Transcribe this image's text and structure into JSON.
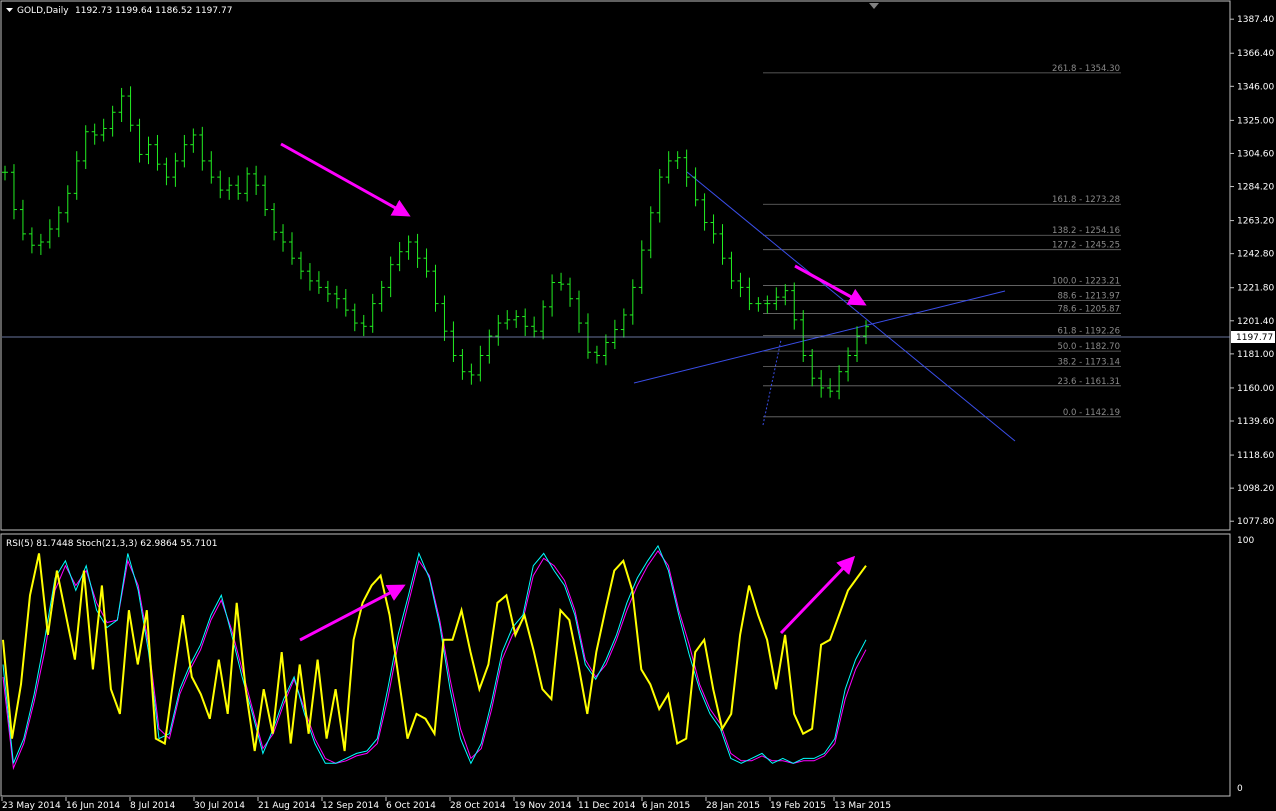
{
  "header": {
    "symbol_label": "GOLD,Daily",
    "ohlc_text": "1192.73 1199.64 1186.52 1197.77"
  },
  "indicator_header": {
    "text": "RSI(5) 81.7448  Stoch(21,3,3) 62.9864 55.7101"
  },
  "colors": {
    "background": "#000000",
    "candle": "#22ee22",
    "rsi": "#ffff00",
    "stoch_main": "#00ffff",
    "stoch_signal": "#ff00ff",
    "arrows": "#ff00ff",
    "trendline": "#3a4ee8",
    "fibo": "#707070",
    "frame": "#c0c0c0"
  },
  "chart_data": [
    {
      "type": "line",
      "title": "GOLD,Daily",
      "ylim": [
        1073.0,
        1398.0
      ],
      "y_ticks": [
        "1387.40",
        "1366.40",
        "1346.00",
        "1325.00",
        "1304.60",
        "1284.20",
        "1263.20",
        "1242.80",
        "1221.80",
        "1201.40",
        "1181.00",
        "1160.00",
        "1139.60",
        "1118.60",
        "1098.20",
        "1077.80"
      ],
      "current_price": "1197.77",
      "x_tick_labels": [
        "23 May 2014",
        "16 Jun 2014",
        "8 Jul 2014",
        "30 Jul 2014",
        "21 Aug 2014",
        "12 Sep 2014",
        "6 Oct 2014",
        "28 Oct 2014",
        "19 Nov 2014",
        "11 Dec 2014",
        "6 Jan 2015",
        "28 Jan 2015",
        "19 Feb 2015",
        "13 Mar 2015"
      ],
      "series": [
        {
          "values": [
            1293,
            1270,
            1255,
            1248,
            1250,
            1258,
            1268,
            1280,
            1300,
            1318,
            1316,
            1320,
            1330,
            1340,
            1322,
            1304,
            1310,
            1298,
            1290,
            1300,
            1310,
            1316,
            1300,
            1290,
            1282,
            1285,
            1280,
            1292,
            1285,
            1270,
            1256,
            1250,
            1240,
            1232,
            1226,
            1222,
            1218,
            1215,
            1208,
            1200,
            1198,
            1212,
            1222,
            1236,
            1244,
            1250,
            1240,
            1232,
            1212,
            1195,
            1180,
            1170,
            1168,
            1180,
            1192,
            1200,
            1202,
            1204,
            1198,
            1195,
            1210,
            1225,
            1224,
            1215,
            1200,
            1182,
            1180,
            1188,
            1196,
            1205,
            1222,
            1245,
            1268,
            1290,
            1300,
            1302,
            1290,
            1276,
            1262,
            1255,
            1240,
            1226,
            1222,
            1212,
            1212,
            1212,
            1216,
            1220,
            1202,
            1180,
            1166,
            1160,
            1158,
            1170,
            1180,
            1192,
            1197.77
          ]
        }
      ],
      "fibonacci_levels": [
        {
          "label": "261.8 - 1354.30",
          "price": 1354.3
        },
        {
          "label": "161.8 - 1273.28",
          "price": 1273.28
        },
        {
          "label": "138.2 - 1254.16",
          "price": 1254.16
        },
        {
          "label": "127.2 - 1245.25",
          "price": 1245.25
        },
        {
          "label": "100.0 - 1223.21",
          "price": 1223.21
        },
        {
          "label": "88.6 - 1213.97",
          "price": 1213.97
        },
        {
          "label": "78.6 - 1205.87",
          "price": 1205.87
        },
        {
          "label": "61.8 - 1192.26",
          "price": 1192.26
        },
        {
          "label": "50.0 - 1182.70",
          "price": 1182.7
        },
        {
          "label": "38.2 - 1173.14",
          "price": 1173.14
        },
        {
          "label": "23.6 - 1161.31",
          "price": 1161.31
        },
        {
          "label": "0.0 - 1142.19",
          "price": 1142.19
        }
      ]
    },
    {
      "type": "line",
      "title": "RSI(5) 81.7448  Stoch(21,3,3) 62.9864 55.7101",
      "ylim": [
        0,
        100
      ],
      "y_ticks": [
        "100",
        "0"
      ],
      "series": [
        {
          "name": "RSI(5)",
          "values": [
            60,
            20,
            42,
            78,
            95,
            62,
            88,
            70,
            52,
            88,
            48,
            82,
            40,
            30,
            72,
            50,
            72,
            20,
            18,
            45,
            70,
            45,
            38,
            28,
            52,
            30,
            75,
            40,
            15,
            40,
            22,
            55,
            18,
            50,
            22,
            52,
            20,
            40,
            15,
            60,
            75,
            82,
            86,
            70,
            45,
            20,
            30,
            28,
            22,
            60,
            60,
            72,
            55,
            40,
            50,
            75,
            78,
            62,
            70,
            56,
            40,
            36,
            72,
            68,
            50,
            30,
            55,
            72,
            88,
            92,
            80,
            48,
            42,
            32,
            38,
            18,
            20,
            55,
            60,
            40,
            24,
            30,
            62,
            82,
            70,
            60,
            40,
            62,
            30,
            22,
            24,
            58,
            60,
            70,
            80,
            85,
            90
          ]
        },
        {
          "name": "Stoch main",
          "values": [
            50,
            10,
            20,
            38,
            60,
            85,
            92,
            80,
            90,
            72,
            65,
            68,
            95,
            80,
            55,
            20,
            22,
            40,
            50,
            58,
            70,
            78,
            62,
            45,
            30,
            14,
            24,
            36,
            45,
            30,
            18,
            10,
            10,
            12,
            14,
            15,
            20,
            40,
            62,
            78,
            95,
            85,
            66,
            40,
            20,
            10,
            18,
            35,
            55,
            65,
            70,
            90,
            95,
            88,
            82,
            70,
            50,
            44,
            52,
            62,
            75,
            85,
            92,
            98,
            88,
            70,
            54,
            40,
            30,
            24,
            12,
            10,
            12,
            14,
            10,
            12,
            10,
            12,
            12,
            14,
            20,
            40,
            52,
            60
          ]
        },
        {
          "name": "Stoch signal",
          "values": [
            45,
            8,
            18,
            35,
            55,
            80,
            90,
            82,
            88,
            75,
            67,
            68,
            92,
            82,
            58,
            24,
            20,
            38,
            48,
            56,
            68,
            76,
            64,
            48,
            32,
            16,
            22,
            34,
            44,
            32,
            20,
            12,
            10,
            11,
            13,
            14,
            18,
            36,
            58,
            75,
            92,
            86,
            68,
            44,
            24,
            12,
            16,
            32,
            52,
            62,
            68,
            86,
            93,
            90,
            84,
            72,
            52,
            45,
            50,
            60,
            72,
            82,
            90,
            96,
            90,
            72,
            58,
            42,
            32,
            26,
            14,
            11,
            11,
            13,
            11,
            11,
            10,
            11,
            11,
            13,
            18,
            36,
            48,
            56
          ]
        }
      ]
    }
  ]
}
